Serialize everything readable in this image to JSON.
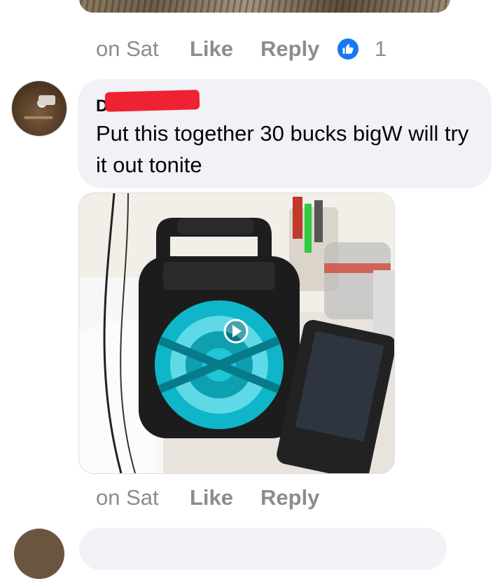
{
  "comment1": {
    "time": "on Sat",
    "like_label": "Like",
    "reply_label": "Reply",
    "reaction_count": "1",
    "reaction_icon": "thumbs-up-icon",
    "reaction_color": "#1877f2"
  },
  "comment2": {
    "author_fragment": "D          es",
    "text": "Put this together 30 bucks bigW will try it out tonite",
    "time": "on Sat",
    "like_label": "Like",
    "reply_label": "Reply",
    "attachment_icon": "play-icon"
  },
  "colors": {
    "bubble": "#f0f2f5",
    "meta_text": "#8a8d91",
    "redaction": "#ee2233",
    "speaker_accent": "#1ec6d8"
  }
}
